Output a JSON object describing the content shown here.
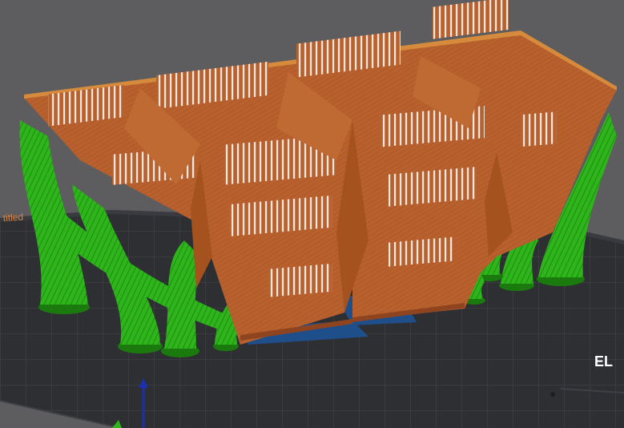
{
  "viewport": {
    "tab_label": "titled",
    "bed_logo_text": "EL",
    "colors": {
      "background": "#5d5d5f",
      "bed": "#2e2f33",
      "bed_grid": "#45464b",
      "model_orange": "#b8602e",
      "model_orange_dark": "#8f4420",
      "support_green": "#2fb51c",
      "support_green_dark": "#1b7a0e",
      "brim_blue": "#1f4f8a",
      "axis_z": "#1c2fb0",
      "tab_orange": "#e0823a"
    },
    "icons": {
      "z_axis": "arrow-up-icon"
    }
  }
}
